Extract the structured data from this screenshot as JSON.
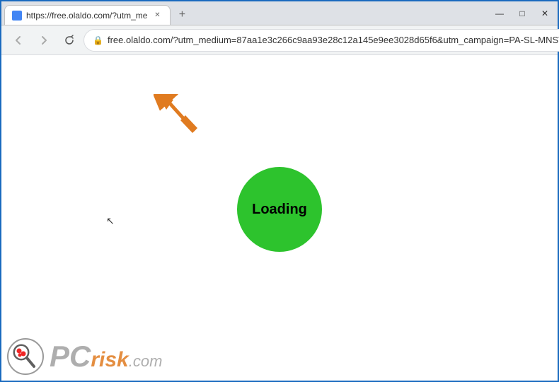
{
  "window": {
    "title": "https://free.olaldo.com/?utm_me...",
    "tab_title": "https://free.olaldo.com/?utm_me",
    "url": "free.olaldo.com/?utm_medium=87aa1e3c266c9aa93e28c12a145e9ee3028d65f6&utm_campaign=PA-SL-MNST-MNTZ-GIOV-A...",
    "controls": {
      "minimize": "—",
      "maximize": "□",
      "close": "✕"
    }
  },
  "nav": {
    "back_label": "←",
    "forward_label": "→",
    "close_label": "✕",
    "lock_icon": "🔒",
    "star_label": "☆",
    "menu_label": "⋮"
  },
  "page": {
    "loading_text": "Loading",
    "loading_color": "#2dc32d"
  },
  "watermark": {
    "brand": "PC",
    "rest": "risk",
    "tld": ".com"
  }
}
